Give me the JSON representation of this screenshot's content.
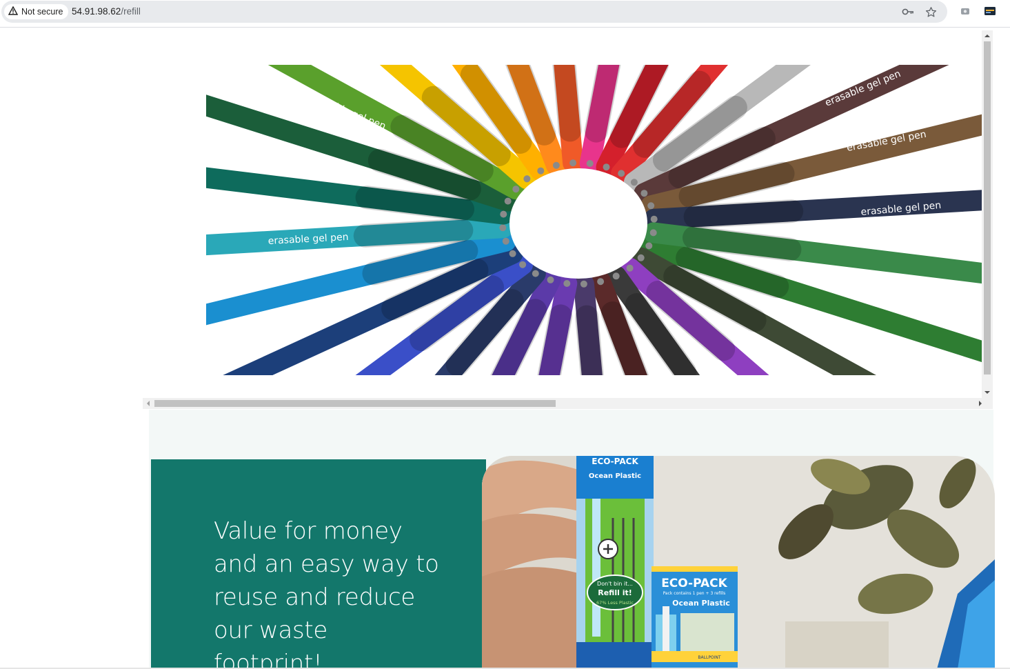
{
  "browser": {
    "security_label": "Not secure",
    "url_host": "54.91.98.62",
    "url_path": "/refill",
    "icons": [
      "warning-icon",
      "key-icon",
      "star-icon",
      "extension-icon",
      "profile-card-icon"
    ]
  },
  "hero": {
    "image_label": "erasable gel pen",
    "pen_colors": [
      "#2e7d32",
      "#3e4a35",
      "#8e3fc0",
      "#3a3a3a",
      "#5b2a2a",
      "#4a3a6a",
      "#6a3bb0",
      "#5b3aa8",
      "#2a3b6a",
      "#3a4fc8",
      "#1c3f7a",
      "#1a8fd0",
      "#2aa8b8",
      "#0e6b5c",
      "#1b5e3a",
      "#5aa02c",
      "#f5c400",
      "#ffb000",
      "#ff8a1c",
      "#f05a28",
      "#e8348c",
      "#d4202c",
      "#e03030",
      "#b8b8b8",
      "#5a3a3a",
      "#7a5a3a",
      "#2a3450",
      "#3a8a4a"
    ]
  },
  "promo": {
    "heading": "Value for money and an easy way to reuse and reduce our waste footprint!",
    "background_color": "#13776b"
  },
  "product": {
    "pack_title": "ECO-PACK",
    "pack_subtitle": "Pack contains 1 pen + 3 refills",
    "brand": "Ocean Plastic",
    "badge_line1": "Don't bin it...",
    "badge_line2": "Refill it!",
    "badge_line3": "67% Less Plastic",
    "ballpoint": "BALLPOINT"
  }
}
